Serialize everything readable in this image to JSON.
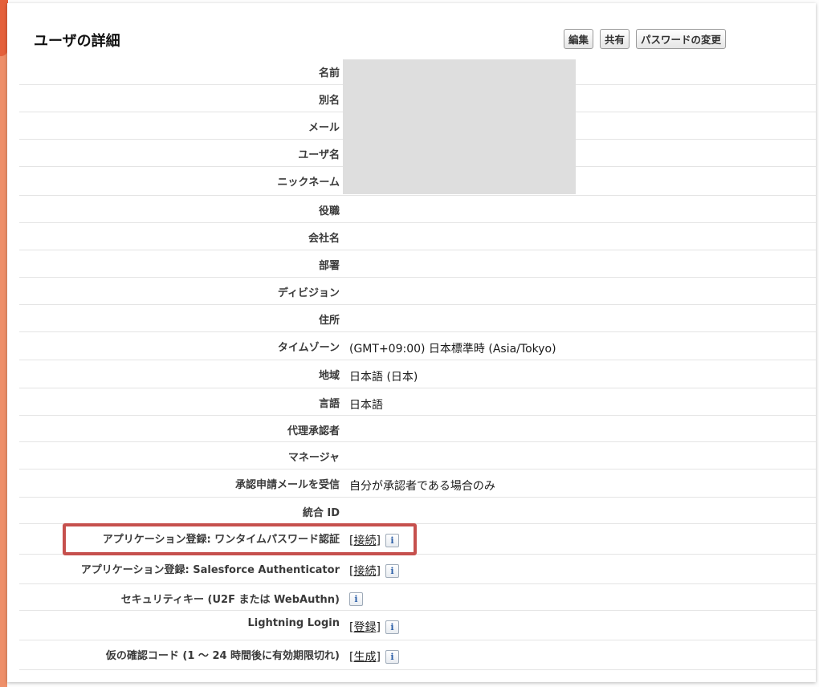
{
  "page": {
    "title": "ユーザの詳細",
    "buttons": {
      "edit": "編集",
      "share": "共有",
      "change_password": "パスワードの変更"
    },
    "info_label": "i"
  },
  "fields": [
    {
      "label": "名前",
      "value": ""
    },
    {
      "label": "別名",
      "value": ""
    },
    {
      "label": "メール",
      "value": ""
    },
    {
      "label": "ユーザ名",
      "value": ""
    },
    {
      "label": "ニックネーム",
      "value": ""
    },
    {
      "label": "役職",
      "value": ""
    },
    {
      "label": "会社名",
      "value": ""
    },
    {
      "label": "部署",
      "value": ""
    },
    {
      "label": "ディビジョン",
      "value": ""
    },
    {
      "label": "住所",
      "value": ""
    },
    {
      "label": "タイムゾーン",
      "value": "(GMT+09:00) 日本標準時 (Asia/Tokyo)"
    },
    {
      "label": "地域",
      "value": "日本語 (日本)"
    },
    {
      "label": "言語",
      "value": "日本語"
    },
    {
      "label": "代理承認者",
      "value": ""
    },
    {
      "label": "マネージャ",
      "value": ""
    },
    {
      "label": "承認申請メールを受信",
      "value": "自分が承認者である場合のみ"
    },
    {
      "label": "統合 ID",
      "value": ""
    },
    {
      "label": "アプリケーション登録: ワンタイムパスワード認証",
      "link": "[接続]"
    },
    {
      "label": "アプリケーション登録: Salesforce Authenticator",
      "link": "[接続]"
    },
    {
      "label": "セキュリティキー (U2F または WebAuthn)",
      "link": ""
    },
    {
      "label": "Lightning Login",
      "link": "[登録]"
    },
    {
      "label": "仮の確認コード (1 ～ 24 時間後に有効期限切れ)",
      "link": "[生成]"
    }
  ],
  "colors": {
    "accent": "#ee8f69",
    "highlight": "#c6504d",
    "redaction": "#dedede"
  }
}
